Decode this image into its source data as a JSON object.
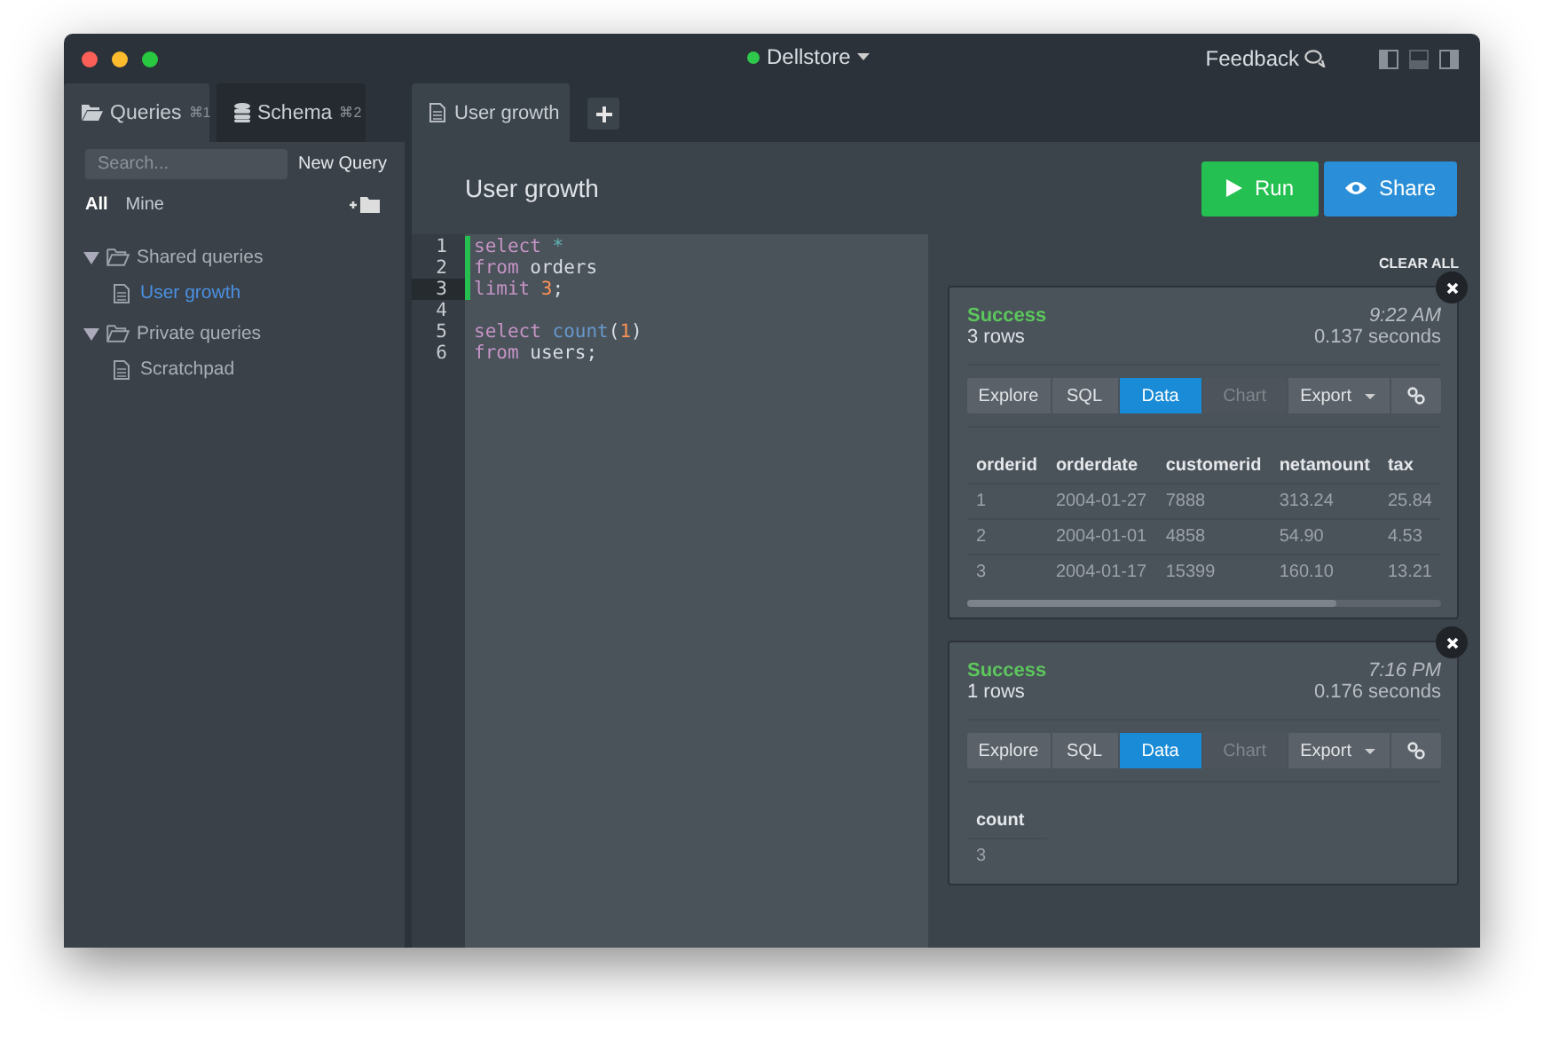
{
  "window": {
    "connection": {
      "name": "Dellstore",
      "connected": true
    },
    "feedback": "Feedback"
  },
  "sidebar": {
    "tabs": [
      {
        "label": "Queries",
        "shortcut": "⌘1",
        "selected": true
      },
      {
        "label": "Schema",
        "shortcut": "⌘2",
        "selected": false
      }
    ],
    "search": {
      "placeholder": "Search..."
    },
    "new_query": "New Query",
    "filters": [
      {
        "label": "All",
        "selected": true
      },
      {
        "label": "Mine",
        "selected": false
      }
    ],
    "tree": [
      {
        "label": "Shared queries",
        "expanded": true,
        "children": [
          {
            "label": "User growth",
            "selected": true
          }
        ]
      },
      {
        "label": "Private queries",
        "expanded": true,
        "children": [
          {
            "label": "Scratchpad",
            "selected": false
          }
        ]
      }
    ]
  },
  "editor_tabs": [
    {
      "label": "User growth",
      "selected": true
    }
  ],
  "query": {
    "title": "User growth",
    "run": "Run",
    "share": "Share"
  },
  "editor": {
    "lines": [
      {
        "number": "1",
        "current": false,
        "changed": true,
        "tokens": [
          {
            "text": "select",
            "kind": "keyword"
          },
          {
            "text": " *",
            "kind": "operator"
          }
        ]
      },
      {
        "number": "2",
        "current": false,
        "changed": true,
        "tokens": [
          {
            "text": "from",
            "kind": "keyword"
          },
          {
            "text": " orders",
            "kind": "plain"
          }
        ]
      },
      {
        "number": "3",
        "current": true,
        "changed": true,
        "tokens": [
          {
            "text": "limit",
            "kind": "keyword"
          },
          {
            "text": " 3",
            "kind": "number"
          },
          {
            "text": ";",
            "kind": "plain"
          }
        ]
      },
      {
        "number": "4",
        "current": false,
        "changed": false
      },
      {
        "number": "5",
        "current": false,
        "changed": false,
        "tokens": [
          {
            "text": "select",
            "kind": "keyword"
          },
          {
            "text": " count",
            "kind": "function"
          },
          {
            "text": "(",
            "kind": "plain"
          },
          {
            "text": "1",
            "kind": "number"
          },
          {
            "text": ")",
            "kind": "plain"
          }
        ]
      },
      {
        "number": "6",
        "current": false,
        "changed": false,
        "tokens": [
          {
            "text": "from",
            "kind": "keyword"
          },
          {
            "text": " users;",
            "kind": "plain"
          }
        ]
      }
    ]
  },
  "results": {
    "clear_all": "CLEAR ALL",
    "items": [
      {
        "status": "Success",
        "time": "9:22 AM",
        "rows": "3 rows",
        "duration": "0.137 seconds",
        "scrollable": true,
        "tabs": [
          {
            "kind": "text",
            "label": "Explore",
            "selected": false,
            "disabled": false
          },
          {
            "kind": "text",
            "label": "SQL",
            "selected": false,
            "disabled": false
          },
          {
            "kind": "text",
            "label": "Data",
            "selected": true,
            "disabled": false
          },
          {
            "kind": "text",
            "label": "Chart",
            "selected": false,
            "disabled": true
          },
          {
            "kind": "dropdown",
            "label": "Export",
            "selected": false,
            "disabled": false
          },
          {
            "kind": "link",
            "selected": false,
            "disabled": false
          }
        ],
        "table": {
          "columns": [
            "orderid",
            "orderdate",
            "customerid",
            "netamount",
            "tax"
          ],
          "rows": [
            [
              "1",
              "2004-01-27",
              "7888",
              "313.24",
              "25.84"
            ],
            [
              "2",
              "2004-01-01",
              "4858",
              "54.90",
              "4.53"
            ],
            [
              "3",
              "2004-01-17",
              "15399",
              "160.10",
              "13.21"
            ]
          ]
        }
      },
      {
        "status": "Success",
        "time": "7:16 PM",
        "rows": "1 rows",
        "duration": "0.176 seconds",
        "scrollable": false,
        "tabs": [
          {
            "kind": "text",
            "label": "Explore",
            "selected": false,
            "disabled": false
          },
          {
            "kind": "text",
            "label": "SQL",
            "selected": false,
            "disabled": false
          },
          {
            "kind": "text",
            "label": "Data",
            "selected": true,
            "disabled": false
          },
          {
            "kind": "text",
            "label": "Chart",
            "selected": false,
            "disabled": true
          },
          {
            "kind": "dropdown",
            "label": "Export",
            "selected": false,
            "disabled": false
          },
          {
            "kind": "link",
            "selected": false,
            "disabled": false
          }
        ],
        "table": {
          "columns": [
            "count"
          ],
          "rows": [
            [
              "3"
            ]
          ]
        }
      }
    ]
  }
}
